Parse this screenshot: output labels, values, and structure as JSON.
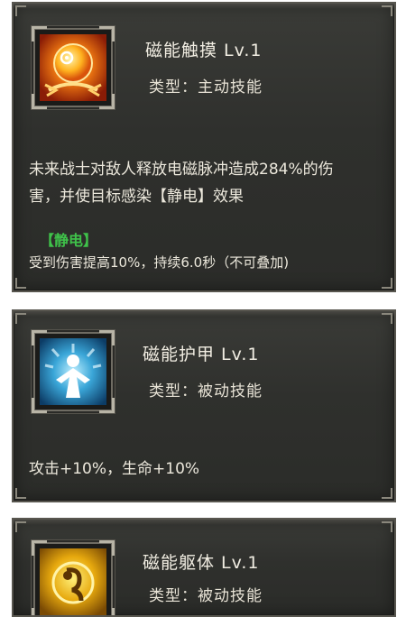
{
  "skills": [
    {
      "name": "磁能触摸 Lv.1",
      "type": "类型：主动技能",
      "icon": "orange-electric-orb-icon",
      "description_line1": "未来战士对敌人释放电磁脉冲造成284%的伤",
      "description_line2": "害，并使目标感染【静电】效果",
      "tag": "【静电】",
      "effect": "受到伤害提高10%，持续6.0秒（不可叠加)"
    },
    {
      "name": "磁能护甲 Lv.1",
      "type": "类型：被动技能",
      "icon": "blue-armor-figure-icon",
      "description_line1": "攻击+10%，生命+10%"
    },
    {
      "name": "磁能躯体 Lv.1",
      "type": "类型：被动技能",
      "icon": "gold-body-icon"
    }
  ],
  "colors": {
    "panel_bg": "#2f302d",
    "panel_border": "#58564f",
    "text": "#ece8dc",
    "tag_green": "#3fc24a"
  }
}
